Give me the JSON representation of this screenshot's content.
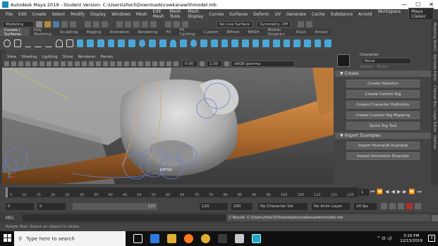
{
  "titlebar": {
    "title": "Autodesk Maya 2019 - Student Version: C:\\Users\\sfox3\\Downloads\\rawkanawithmodel.mb",
    "minimize": "—",
    "maximize": "☐",
    "close": "✕"
  },
  "menu": {
    "items": [
      "File",
      "Edit",
      "Create",
      "Select",
      "Modify",
      "Display",
      "Windows",
      "Mesh",
      "Edit Mesh",
      "Mesh Tools",
      "Mesh Display",
      "Curves",
      "Surfaces",
      "Deform",
      "UV",
      "Generate",
      "Cache",
      "Substance",
      "Arnold"
    ],
    "workspace_label": "Workspace :",
    "workspace_value": "Maya Classic"
  },
  "statusline": {
    "mode": "Modeling",
    "live_surface": "No Live Surface",
    "symmetry": "Symmetry: Off"
  },
  "shelf": {
    "tabs": [
      "Curves / Surfaces",
      "Poly Modeling",
      "Sculpting",
      "Rigging",
      "Animation",
      "Rendering",
      "FX",
      "FX Caching",
      "Custom",
      "Bifrost",
      "MASH",
      "Motion Graphics",
      "XGen",
      "Arnold"
    ],
    "active": 0
  },
  "viewport": {
    "menus": [
      "View",
      "Shading",
      "Lighting",
      "Show",
      "Renderer",
      "Panels"
    ],
    "value_a": "0.00",
    "value_b": "1.00",
    "colorspace": "sRGB gamma",
    "camera_label": "persp"
  },
  "rightpanel": {
    "character_label": "Character",
    "character_value": "None",
    "source_label": "Source",
    "source_value": "None",
    "create_header": "Create",
    "create_buttons": [
      "Create Skeleton",
      "Create Control Rig",
      "Create Character Definition",
      "Create Custom Rig Mapping",
      "Quick Rig Tool"
    ],
    "import_header": "Import Examples",
    "import_buttons": [
      "Import HumanIK Example",
      "Import Animation Example"
    ]
  },
  "rightedge": {
    "tabs": [
      "Modeling Toolkit",
      "Attribute Editor",
      "Channel Box / Layer Editor",
      "Outliner"
    ]
  },
  "timeslider": {
    "ticks": [
      "5",
      "10",
      "15",
      "20",
      "25",
      "30",
      "35",
      "40",
      "45",
      "50",
      "55",
      "60",
      "65",
      "70",
      "75",
      "80",
      "85",
      "90",
      "95",
      "100",
      "105",
      "110",
      "115",
      "120"
    ],
    "current_frame": "1"
  },
  "range": {
    "start": "0",
    "start_inner": "0",
    "slider_end": "120",
    "end": "120",
    "max": "200",
    "character_set": "No Character Set",
    "anim_layer": "No Anim Layer",
    "fps": "24 fps"
  },
  "mel": {
    "label": "MEL",
    "result": "// Result: C:/Users/sfox3/Downloads/rawkanawithmodel.mb"
  },
  "help": {
    "text": "Rotate Tool: Select an object to rotate."
  },
  "taskbar": {
    "search_placeholder": "Type here to search",
    "time": "3:16 PM",
    "date": "12/13/2019",
    "notification_count": "3"
  },
  "colors": {
    "accent": "#5285a6",
    "wood": "#b06a2c",
    "hand": "#c8c8c8",
    "bg": "#444444"
  }
}
